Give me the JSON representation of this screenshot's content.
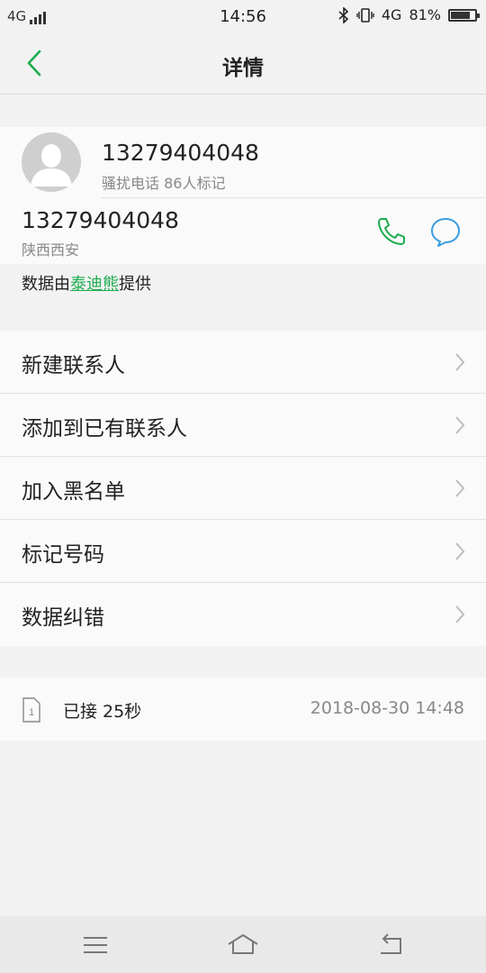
{
  "status_bar": {
    "network_left": "4G",
    "time": "14:56",
    "network_right": "4G",
    "battery": "81%",
    "battery_level": 0.81
  },
  "header": {
    "title": "详情"
  },
  "caller": {
    "number": "13279404048",
    "tag": "骚扰电话 86人标记"
  },
  "number_row": {
    "number": "13279404048",
    "location": "陕西西安"
  },
  "provider": {
    "prefix": "数据由",
    "name": "泰迪熊",
    "suffix": "提供"
  },
  "actions": [
    {
      "label": "新建联系人"
    },
    {
      "label": "添加到已有联系人"
    },
    {
      "label": "加入黑名单"
    },
    {
      "label": "标记号码"
    },
    {
      "label": "数据纠错"
    }
  ],
  "call_log": {
    "sim": "1",
    "status": "已接 25秒",
    "datetime": "2018-08-30 14:48"
  },
  "colors": {
    "accent": "#1cad4f",
    "message": "#3a9de0"
  }
}
